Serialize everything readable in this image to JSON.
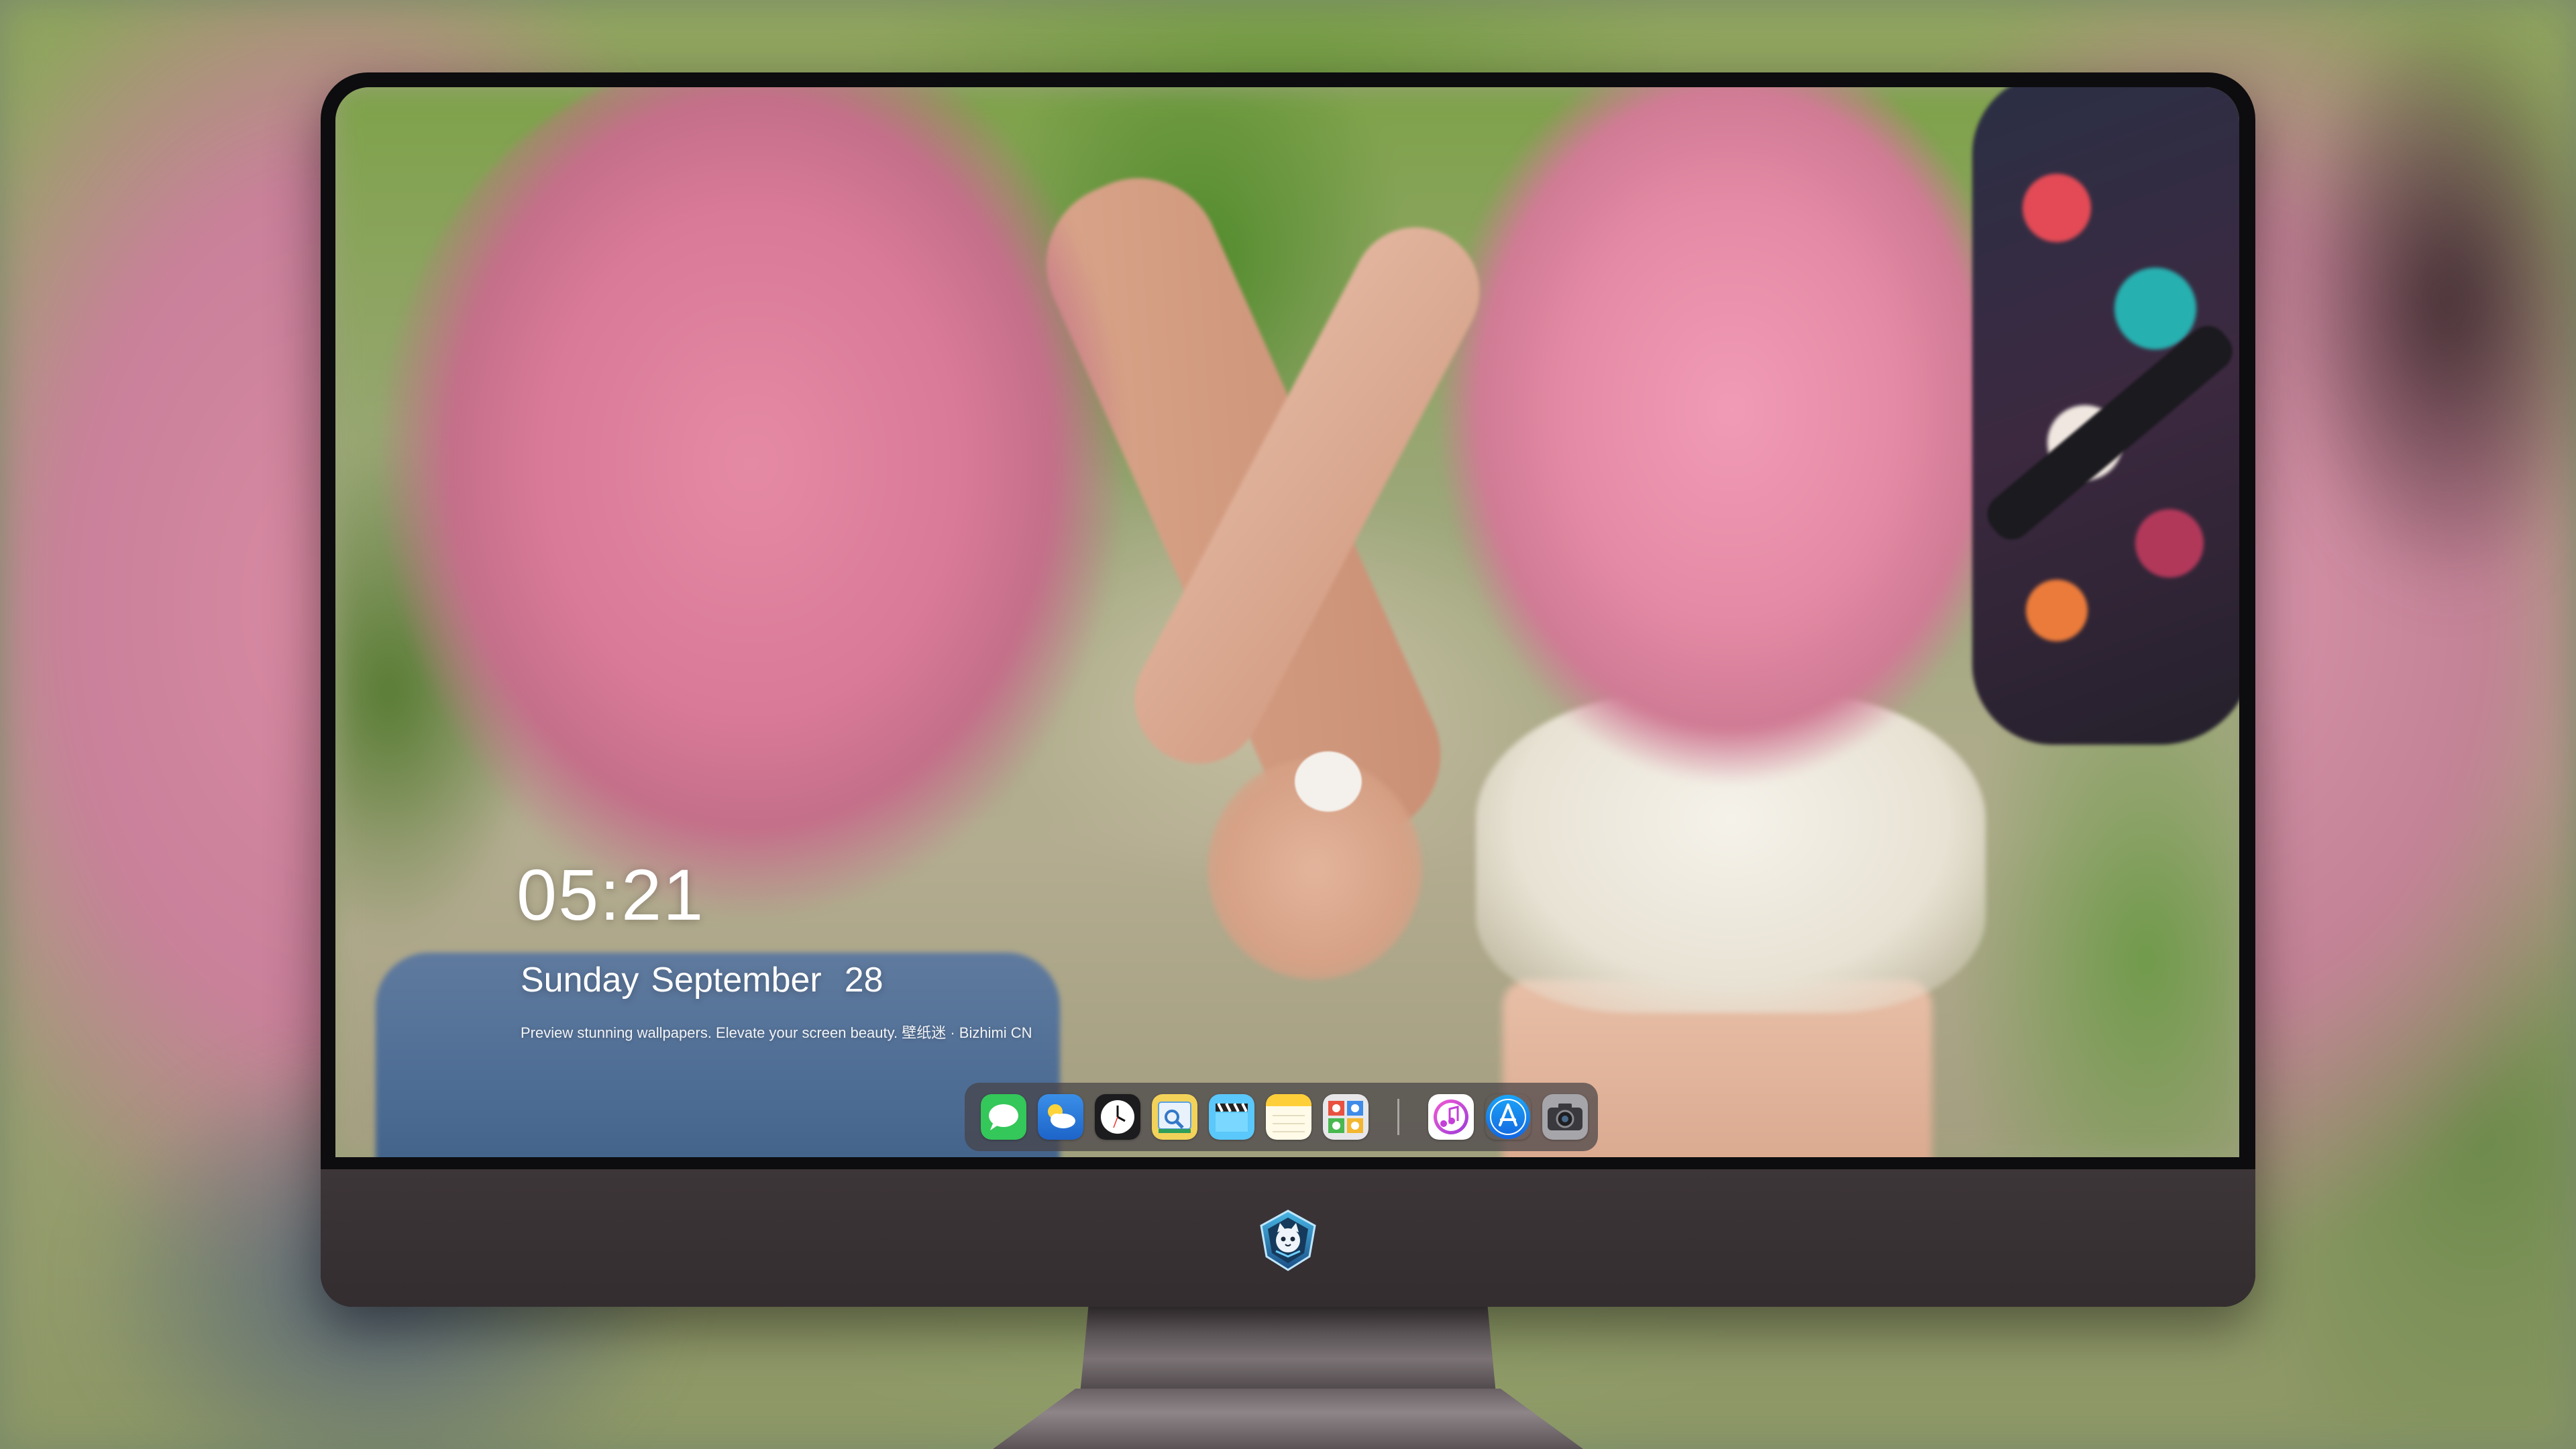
{
  "lockscreen": {
    "time": "05:21",
    "weekday": "Sunday",
    "month": "September",
    "day": "28",
    "tagline": "Preview stunning wallpapers. Elevate your screen beauty. 壁纸迷 · Bizhimi CN"
  },
  "dock": {
    "apps": [
      {
        "name": "messages-icon",
        "color": "#34c759"
      },
      {
        "name": "weather-icon",
        "color": "#2f7fe0"
      },
      {
        "name": "clock-icon",
        "color": "#1c1c1e"
      },
      {
        "name": "preview-icon",
        "color": "#f2c230"
      },
      {
        "name": "clips-icon",
        "color": "#5ac8fa"
      },
      {
        "name": "notes-icon",
        "color": "#ffd04a"
      },
      {
        "name": "photo-booth-icon",
        "color": "#e8e8e8"
      },
      {
        "name": "itunes-icon",
        "color": "#d23bdb"
      },
      {
        "name": "app-store-icon",
        "color": "#1f8ff5"
      },
      {
        "name": "camera-icon",
        "color": "#6e6e72"
      }
    ]
  },
  "device": {
    "logo_icon": "cat-shield-logo-icon"
  }
}
